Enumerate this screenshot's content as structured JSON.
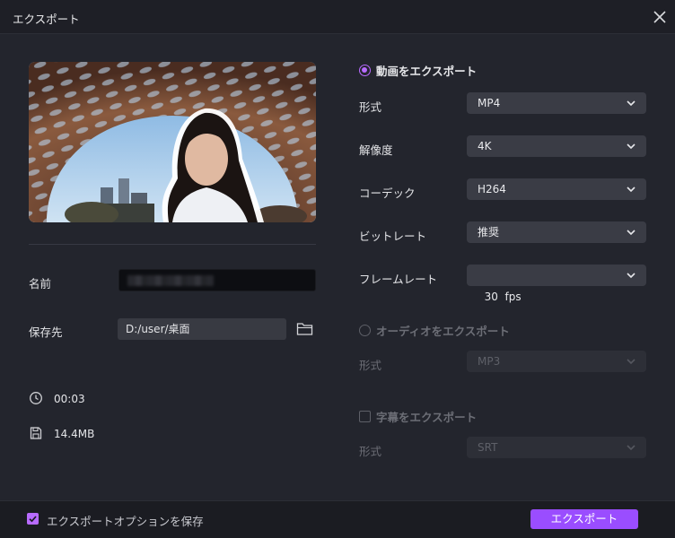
{
  "window": {
    "title": "エクスポート"
  },
  "left": {
    "name_label": "名前",
    "name_value": "",
    "save_to_label": "保存先",
    "save_path": "D:/user/桌面",
    "duration": "00:03",
    "file_size": "14.4MB"
  },
  "video": {
    "section_label": "動画をエクスポート",
    "format_label": "形式",
    "format_value": "MP4",
    "resolution_label": "解像度",
    "resolution_value": "4K",
    "codec_label": "コーデック",
    "codec_value": "H264",
    "bitrate_label": "ビットレート",
    "bitrate_value": "推奨",
    "framerate_label": "フレームレート",
    "framerate_value": "30  fps"
  },
  "audio": {
    "section_label": "オーディオをエクスポート",
    "format_label": "形式",
    "format_value": "MP3"
  },
  "subtitle": {
    "section_label": "字幕をエクスポート",
    "format_label": "形式",
    "format_value": "SRT"
  },
  "footer": {
    "save_options_label": "エクスポートオプションを保存",
    "save_options_checked": true,
    "export_button": "エクスポート"
  },
  "colors": {
    "accent": "#9a4dff",
    "accent_light": "#b86bff",
    "background": "#23252d",
    "select_bg": "#3a3c45"
  },
  "icons": {
    "close": "close-icon",
    "folder": "folder-icon",
    "clock": "clock-icon",
    "file": "file-size-icon",
    "chevron": "chevron-down-icon"
  }
}
